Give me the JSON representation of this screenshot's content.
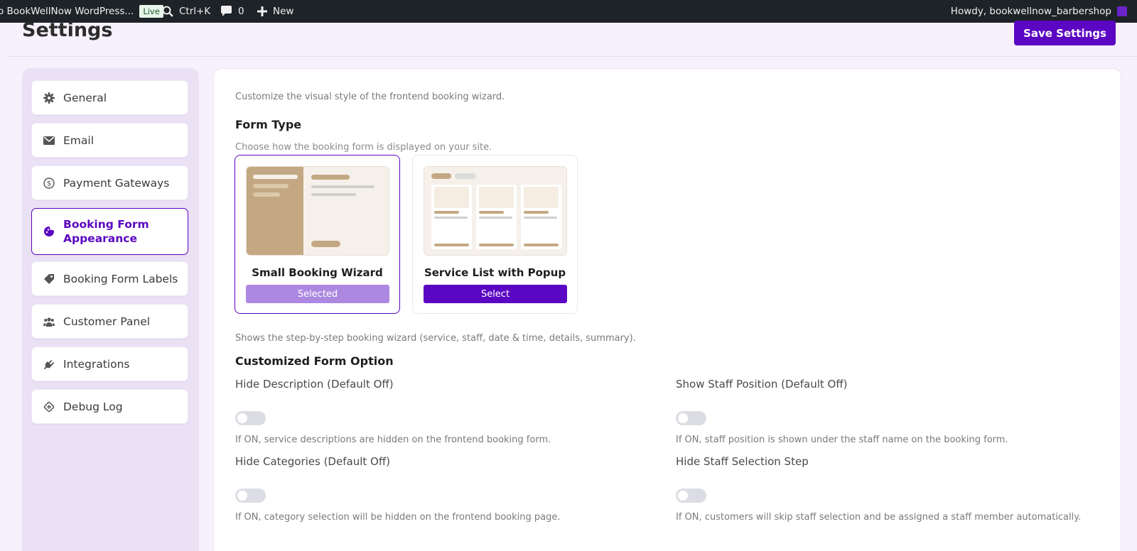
{
  "adminbar": {
    "site_name": "o BookWellNow WordPress...",
    "live_badge": "Live",
    "search_shortcut": "Ctrl+K",
    "comments_count": "0",
    "new_label": "New",
    "howdy": "Howdy, bookwellnow_barbershop"
  },
  "header": {
    "title": "Settings",
    "save_label": "Save Settings"
  },
  "sidebar": {
    "items": [
      {
        "label": "General",
        "icon": "gear-icon"
      },
      {
        "label": "Email",
        "icon": "envelope-icon"
      },
      {
        "label": "Payment Gateways",
        "icon": "dollar-icon"
      },
      {
        "label": "Booking Form Appearance",
        "icon": "palette-icon",
        "active": true
      },
      {
        "label": "Booking Form Labels",
        "icon": "tag-icon"
      },
      {
        "label": "Customer Panel",
        "icon": "users-icon"
      },
      {
        "label": "Integrations",
        "icon": "plug-icon"
      },
      {
        "label": "Debug Log",
        "icon": "bug-icon"
      }
    ]
  },
  "main": {
    "intro": "Customize the visual style of the frontend booking wizard.",
    "form_type": {
      "title": "Form Type",
      "subtitle": "Choose how the booking form is displayed on your site.",
      "options": [
        {
          "name": "Small Booking Wizard",
          "button": "Selected"
        },
        {
          "name": "Service List with Popup",
          "button": "Select"
        }
      ],
      "selected_description": "Shows the step-by-step booking wizard (service, staff, date & time, details, summary)."
    },
    "customized": {
      "title": "Customized Form Option",
      "options": [
        {
          "label": "Hide Description (Default Off)",
          "help": "If ON, service descriptions are hidden on the frontend booking form."
        },
        {
          "label": "Show Staff Position (Default Off)",
          "help": "If ON, staff position is shown under the staff name on the booking form."
        },
        {
          "label": "Hide Categories (Default Off)",
          "help": "If ON, category selection will be hidden on the frontend booking page."
        },
        {
          "label": "Hide Staff Selection Step",
          "help": "If ON, customers will skip staff selection and be assigned a staff member automatically."
        }
      ]
    }
  },
  "colors": {
    "accent": "#5b06c2",
    "accent_light": "#ad88e0",
    "preview_tan": "#c4a883"
  }
}
